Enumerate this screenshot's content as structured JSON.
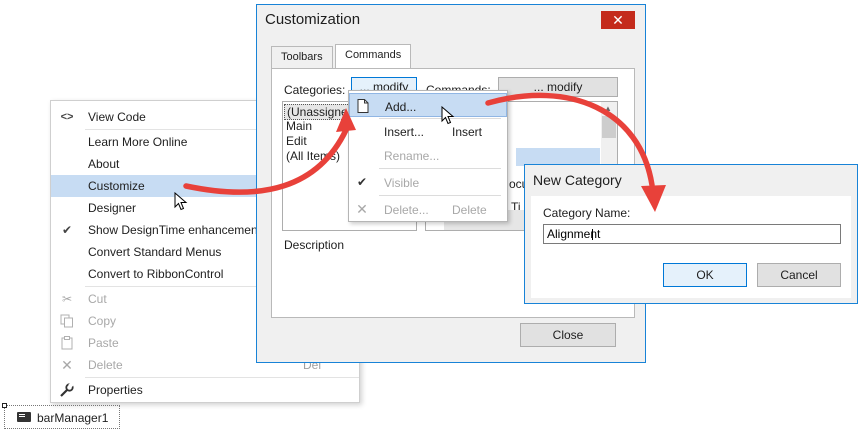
{
  "context_menu": {
    "items": [
      {
        "label": "View Code",
        "icon": "code-icon",
        "shortcut": "",
        "enabled": true,
        "highlighted": false,
        "checked": false
      },
      {
        "label": "Learn More Online",
        "icon": "",
        "shortcut": "",
        "enabled": true,
        "highlighted": false,
        "checked": false
      },
      {
        "label": "About",
        "icon": "",
        "shortcut": "",
        "enabled": true,
        "highlighted": false,
        "checked": false
      },
      {
        "label": "Customize",
        "icon": "",
        "shortcut": "",
        "enabled": true,
        "highlighted": true,
        "checked": false
      },
      {
        "label": "Designer",
        "icon": "",
        "shortcut": "",
        "enabled": true,
        "highlighted": false,
        "checked": false
      },
      {
        "label": "Show DesignTime enhancement",
        "icon": "checkmark-icon",
        "shortcut": "",
        "enabled": true,
        "highlighted": false,
        "checked": true
      },
      {
        "label": "Convert Standard Menus",
        "icon": "",
        "shortcut": "",
        "enabled": true,
        "highlighted": false,
        "checked": false
      },
      {
        "label": "Convert to RibbonControl",
        "icon": "",
        "shortcut": "",
        "enabled": true,
        "highlighted": false,
        "checked": false
      },
      {
        "label": "Cut",
        "icon": "scissors-icon",
        "shortcut": "",
        "enabled": false,
        "highlighted": false,
        "checked": false
      },
      {
        "label": "Copy",
        "icon": "copy-icon",
        "shortcut": "",
        "enabled": false,
        "highlighted": false,
        "checked": false
      },
      {
        "label": "Paste",
        "icon": "paste-icon",
        "shortcut": "",
        "enabled": false,
        "highlighted": false,
        "checked": false
      },
      {
        "label": "Delete",
        "icon": "delete-x-icon",
        "shortcut": "Del",
        "enabled": false,
        "highlighted": false,
        "checked": false
      },
      {
        "label": "Properties",
        "icon": "wrench-icon",
        "shortcut": "",
        "enabled": true,
        "highlighted": false,
        "checked": false
      }
    ]
  },
  "component": {
    "label": "barManager1",
    "icon": "bar-manager-icon"
  },
  "customization_dialog": {
    "title": "Customization",
    "close_glyph": "✕",
    "tabs": [
      {
        "label": "Toolbars",
        "active": false
      },
      {
        "label": "Commands",
        "active": true
      }
    ],
    "categories_label": "Categories:",
    "categories_modify": "... modify",
    "commands_label": "Commands:",
    "commands_modify": "... modify",
    "categories": [
      {
        "label": "(Unassigned I",
        "selected": true
      },
      {
        "label": "Main",
        "selected": false
      },
      {
        "label": "Edit",
        "selected": false
      },
      {
        "label": "(All Items)",
        "selected": false
      }
    ],
    "commands_partial": [
      "ocu",
      "Ti"
    ],
    "description_label": "Description",
    "close_button": "Close"
  },
  "dropdown_menu": {
    "items": [
      {
        "label": "Add...",
        "shortcut": "",
        "icon": "new-document-icon",
        "enabled": true,
        "highlighted": true
      },
      {
        "label": "Insert...",
        "shortcut": "Insert",
        "icon": "",
        "enabled": true,
        "highlighted": false
      },
      {
        "label": "Rename...",
        "shortcut": "",
        "icon": "",
        "enabled": false,
        "highlighted": false
      },
      {
        "label": "Visible",
        "shortcut": "",
        "icon": "checkmark-icon",
        "enabled": false,
        "highlighted": false
      },
      {
        "label": "Delete...",
        "shortcut": "Delete",
        "icon": "delete-x-icon",
        "enabled": false,
        "highlighted": false
      }
    ]
  },
  "new_category_dialog": {
    "title": "New Category",
    "name_label": "Category Name:",
    "name_value": "Alignment",
    "ok_button": "OK",
    "cancel_button": "Cancel"
  },
  "colors": {
    "highlight": "#c7dcf3",
    "window_border": "#1883d7",
    "close_red": "#c42b1c",
    "arrow_red": "#e8413a",
    "disabled_text": "#a8a8a8"
  }
}
